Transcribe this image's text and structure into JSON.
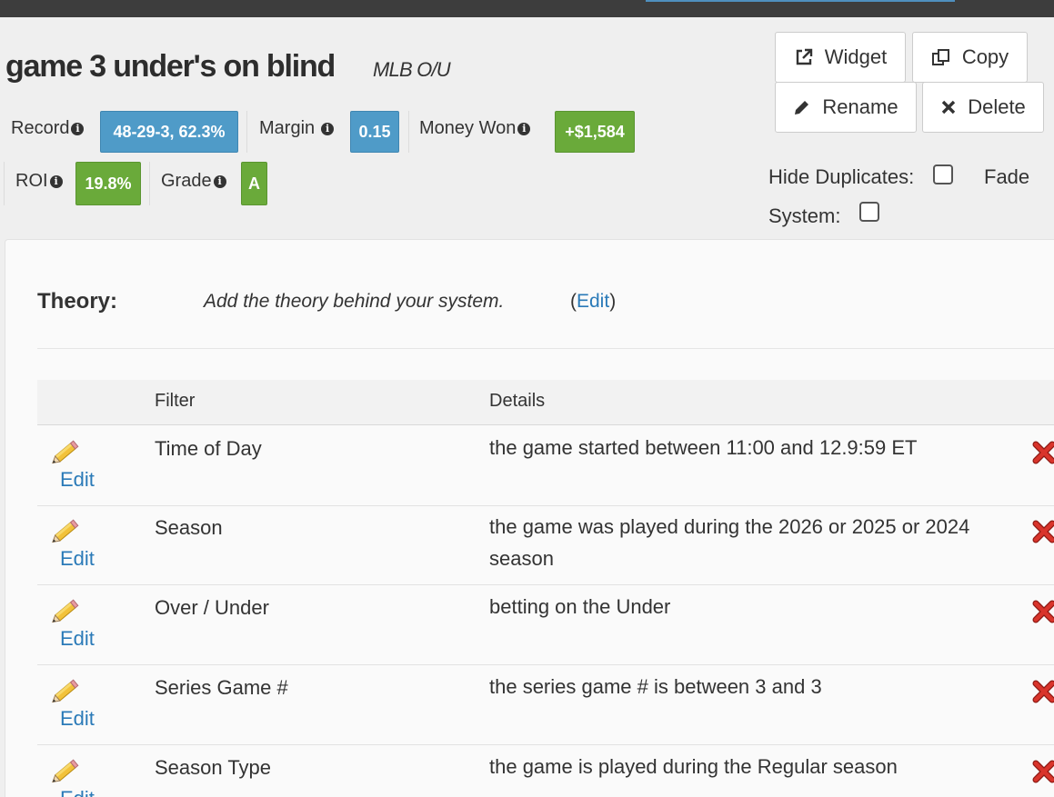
{
  "header": {
    "title": "game 3 under's on blind",
    "subtitle": "MLB O/U"
  },
  "actions": {
    "widget_label": "Widget",
    "copy_label": "Copy",
    "rename_label": "Rename",
    "delete_label": "Delete"
  },
  "stats": {
    "record_label": "Record",
    "record_value": "48-29-3, 62.3%",
    "margin_label": "Margin",
    "margin_value": "0.15",
    "money_label": "Money Won",
    "money_value": "+$1,584",
    "roi_label": "ROI",
    "roi_value": "19.8%",
    "grade_label": "Grade",
    "grade_value": "A",
    "info_glyph": "i"
  },
  "options": {
    "hide_duplicates_label": "Hide Duplicates:",
    "fade_label": "Fade",
    "system_label": "System:"
  },
  "theory": {
    "label": "Theory:",
    "text": "Add the theory behind your system.",
    "edit_open": "(",
    "edit_label": "Edit",
    "edit_close": ")"
  },
  "table": {
    "columns": [
      "Filter",
      "Details"
    ],
    "edit_label": "Edit",
    "rows": [
      {
        "filter": "Time of Day",
        "details": "the game started between 11:00 and 12.9:59 ET"
      },
      {
        "filter": "Season",
        "details": "the game was played during the 2026 or 2025 or 2024 season"
      },
      {
        "filter": "Over / Under",
        "details": "betting on the Under"
      },
      {
        "filter": "Series Game #",
        "details": "the series game # is between 3 and 3"
      },
      {
        "filter": "Season Type",
        "details": "the game is played during the Regular season"
      }
    ]
  },
  "colors": {
    "badge_blue": "#4f9bc8",
    "badge_green": "#6aaa3a",
    "link": "#2a7ab8",
    "delete_red": "#c9302c"
  },
  "icons": {
    "widget": "external-link-icon",
    "copy": "copy-icon",
    "rename": "pencil-icon",
    "delete": "close-icon",
    "info": "info-icon",
    "row_edit": "pencil-icon",
    "row_delete": "red-x-icon"
  }
}
